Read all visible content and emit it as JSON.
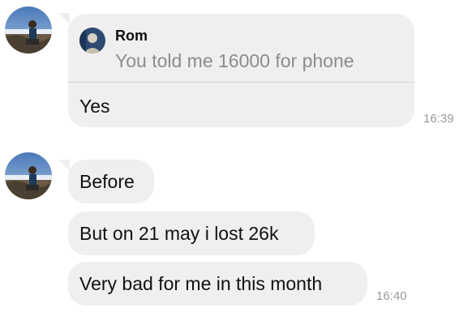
{
  "messages": {
    "group1": {
      "reply": {
        "author": "Rom",
        "quoted_text": "You told me 16000 for phone"
      },
      "text": "Yes",
      "time": "16:39"
    },
    "group2": {
      "bubbles": [
        "Before",
        "But on 21 may i lost 26k",
        "Very bad for me in this month"
      ],
      "time": "16:40"
    }
  }
}
